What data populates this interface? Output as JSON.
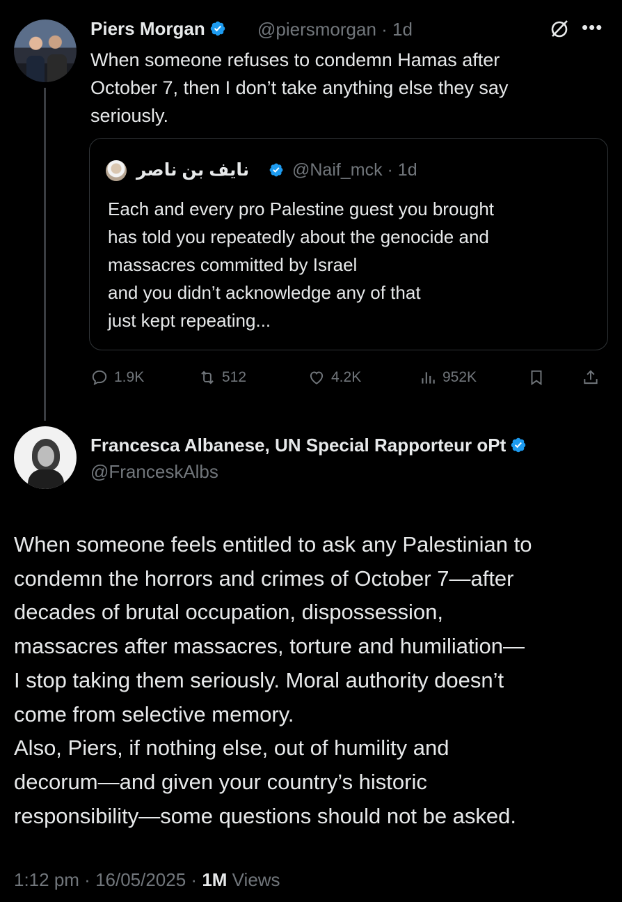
{
  "tweet1": {
    "name": "Piers Morgan",
    "handle": "@piersmorgan",
    "time": "1d",
    "text": "When someone refuses to condemn Hamas after\nOctober 7, then I don’t take anything else they say\nseriously.",
    "quote": {
      "name": "نايف بن ناصر",
      "handle": "@Naif_mck",
      "time": "1d",
      "text": "Each and every pro Palestine guest you brought\nhas told you repeatedly about the genocide and\nmassacres committed by Israel\nand you didn’t acknowledge any of that\njust kept repeating..."
    },
    "actions": {
      "replies": "1.9K",
      "retweets": "512",
      "likes": "4.2K",
      "views": "952K"
    }
  },
  "tweet2": {
    "name": "Francesca Albanese, UN Special Rapporteur oPt",
    "handle": "@FranceskAlbs",
    "text": "When someone feels entitled to ask any Palestinian to\ncondemn the horrors and crimes of October 7—after\ndecades of brutal occupation, dispossession,\nmassacres after massacres, torture and humiliation—\nI stop taking them seriously. Moral authority doesn’t\ncome from selective memory.\nAlso, Piers, if nothing else, out of humility and\ndecorum—and given your country’s historic\nresponsibility—some questions should not be asked.",
    "time": "1:12 pm",
    "date": "16/05/2025",
    "views_count": "1M",
    "views_label": "Views"
  },
  "colors": {
    "background": "#000000",
    "text": "#e7e9ea",
    "muted": "#71767b",
    "verified": "#1d9bf0",
    "border": "#2f3336"
  },
  "icons": [
    "verified-badge-icon",
    "grok-icon",
    "more-icon",
    "reply-icon",
    "retweet-icon",
    "like-icon",
    "views-icon",
    "bookmark-icon",
    "share-icon"
  ]
}
